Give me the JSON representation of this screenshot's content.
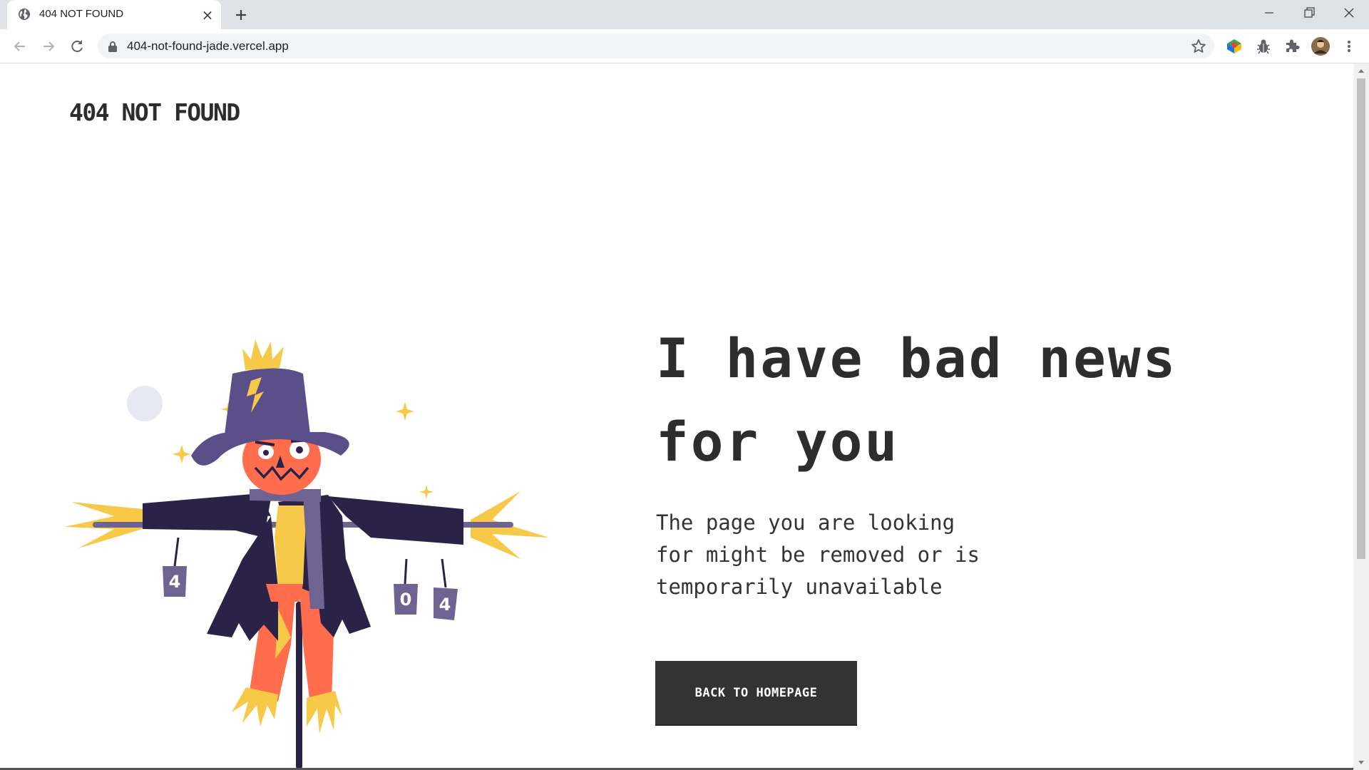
{
  "browser": {
    "tab_title": "404 NOT FOUND",
    "url": "404-not-found-jade.vercel.app",
    "favicon": "globe-icon",
    "icons": [
      "back-arrow-icon",
      "forward-arrow-icon",
      "reload-icon",
      "lock-icon",
      "star-icon",
      "colorful-extension-icon",
      "bug-extension-icon",
      "puzzle-extensions-icon",
      "profile-avatar",
      "kebab-menu-icon",
      "minimize-icon",
      "restore-icon",
      "close-window-icon",
      "new-tab-icon",
      "close-tab-icon"
    ]
  },
  "page": {
    "site_title": "404 NOT FOUND",
    "headline_line1": "I have bad news",
    "headline_line2": "for you",
    "description_line1": "The page you are looking",
    "description_line2": "for might be removed or is",
    "description_line3": "temporarily unavailable",
    "button_label": "BACK TO HOMEPAGE",
    "illustration": {
      "name": "scarecrow-illustration",
      "can_labels": [
        "4",
        "0",
        "4"
      ]
    }
  },
  "colors": {
    "text_dark": "#2d2d2d",
    "button_bg": "#333333",
    "button_text": "#ffffff",
    "coat": "#2b2347",
    "hat": "#5b4f8a",
    "pumpkin": "#ff6d4d",
    "straw": "#f7c948",
    "moon": "#e8e8f2",
    "chrome_bg": "#dee1e6"
  }
}
